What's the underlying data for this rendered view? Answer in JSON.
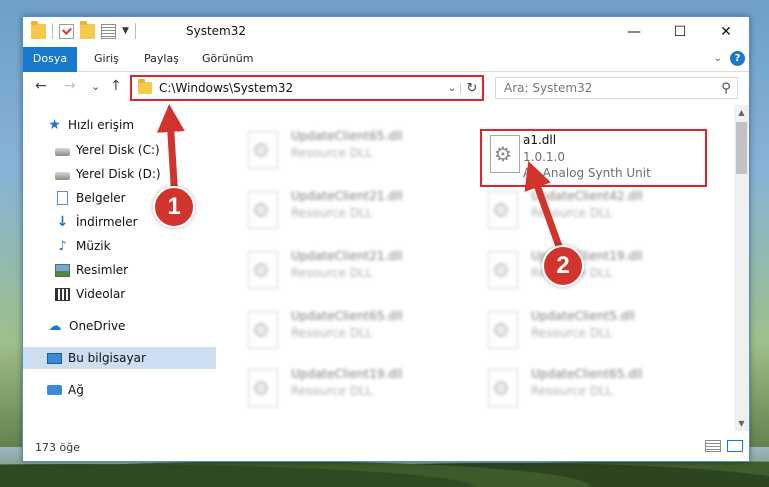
{
  "window": {
    "title": "System32",
    "controls": {
      "minimize": "—",
      "maximize": "☐",
      "close": "✕"
    }
  },
  "ribbon": {
    "tabs": [
      {
        "label": "Dosya"
      },
      {
        "label": "Giriş"
      },
      {
        "label": "Paylaş"
      },
      {
        "label": "Görünüm"
      }
    ],
    "help": "?"
  },
  "nav": {
    "back": "←",
    "forward": "→",
    "recent": "⌄",
    "up": "↑",
    "address": "C:\\Windows\\System32",
    "search_placeholder": "Ara: System32"
  },
  "sidebar": {
    "items": [
      {
        "label": "Hızlı erişim"
      },
      {
        "label": "Yerel Disk (C:)"
      },
      {
        "label": "Yerel Disk (D:)"
      },
      {
        "label": "Belgeler"
      },
      {
        "label": "İndirmeler"
      },
      {
        "label": "Müzik"
      },
      {
        "label": "Resimler"
      },
      {
        "label": "Videolar"
      },
      {
        "label": "OneDrive"
      },
      {
        "label": "Bu bilgisayar"
      },
      {
        "label": "Ağ"
      }
    ]
  },
  "files": [
    {
      "name": "UpdateClient65.dll",
      "type": "Resource DLL"
    },
    {
      "name": "a1.dll",
      "version": "1.0.1.0",
      "description": "A1 Analog Synth Unit"
    },
    {
      "name": "UpdateClient21.dll",
      "type": "Resource DLL"
    },
    {
      "name": "UpdateClient42.dll",
      "type": "Resource DLL"
    },
    {
      "name": "UpdateClient21.dll",
      "type": "Resource DLL"
    },
    {
      "name": "UpdateClient19.dll",
      "type": "Resource DLL"
    },
    {
      "name": "UpdateClient65.dll",
      "type": "Resource DLL"
    },
    {
      "name": "UpdateClient5.dll",
      "type": "Resource DLL"
    },
    {
      "name": "UpdateClient19.dll",
      "type": "Resource DLL"
    },
    {
      "name": "UpdateClient65.dll",
      "type": "Resource DLL"
    }
  ],
  "status": {
    "count": "173 öğe"
  },
  "callouts": [
    {
      "label": "1"
    },
    {
      "label": "2"
    }
  ],
  "colors": {
    "accent": "#1979ca",
    "highlight": "#e0232d",
    "callout": "#d0342c"
  }
}
